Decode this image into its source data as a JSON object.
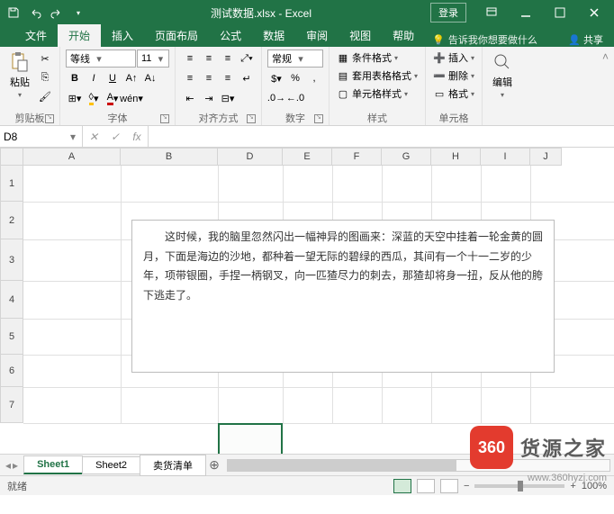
{
  "title": {
    "filename": "测试数据.xlsx",
    "app": "Excel",
    "login": "登录"
  },
  "tabs": {
    "file": "文件",
    "home": "开始",
    "insert": "插入",
    "layout": "页面布局",
    "formulas": "公式",
    "data": "数据",
    "review": "审阅",
    "view": "视图",
    "help": "帮助",
    "tellme": "告诉我你想要做什么",
    "share": "共享"
  },
  "ribbon": {
    "clipboard": {
      "label": "剪贴板",
      "paste": "粘贴"
    },
    "font": {
      "label": "字体",
      "name": "等线",
      "size": "11",
      "bold": "B",
      "italic": "I",
      "underline": "U"
    },
    "align": {
      "label": "对齐方式"
    },
    "number": {
      "label": "数字",
      "format": "常规"
    },
    "styles": {
      "label": "样式",
      "cond": "条件格式",
      "table": "套用表格格式",
      "cell": "单元格样式"
    },
    "cells": {
      "label": "单元格",
      "insert": "插入",
      "delete": "删除",
      "format": "格式"
    },
    "editing": {
      "label": "编辑"
    }
  },
  "namebox": "D8",
  "columns": [
    {
      "name": "A",
      "w": 108
    },
    {
      "name": "B",
      "w": 108
    },
    {
      "name": "D",
      "w": 72
    },
    {
      "name": "E",
      "w": 55
    },
    {
      "name": "F",
      "w": 55
    },
    {
      "name": "G",
      "w": 55
    },
    {
      "name": "H",
      "w": 55
    },
    {
      "name": "I",
      "w": 55
    },
    {
      "name": "J",
      "w": 35
    }
  ],
  "rows": [
    {
      "n": "1",
      "h": 40
    },
    {
      "n": "2",
      "h": 42
    },
    {
      "n": "3",
      "h": 46
    },
    {
      "n": "4",
      "h": 42
    },
    {
      "n": "5",
      "h": 40
    },
    {
      "n": "6",
      "h": 36
    },
    {
      "n": "7",
      "h": 40
    }
  ],
  "textbox": "这时候，我的脑里忽然闪出一幅神异的图画来：深蓝的天空中挂着一轮金黄的圆月，下面是海边的沙地，都种着一望无际的碧绿的西瓜，其间有一个十一二岁的少年，项带银圈，手捏一柄钢叉，向一匹猹尽力的刺去，那猹却将身一扭，反从他的胯下逃走了。",
  "sheets": {
    "s1": "Sheet1",
    "s2": "Sheet2",
    "s3": "卖货清单"
  },
  "status": {
    "ready": "就绪",
    "zoom": "100%"
  },
  "watermark": {
    "badge": "360",
    "text": "货源之家",
    "url": "www.360hyzj.com"
  }
}
